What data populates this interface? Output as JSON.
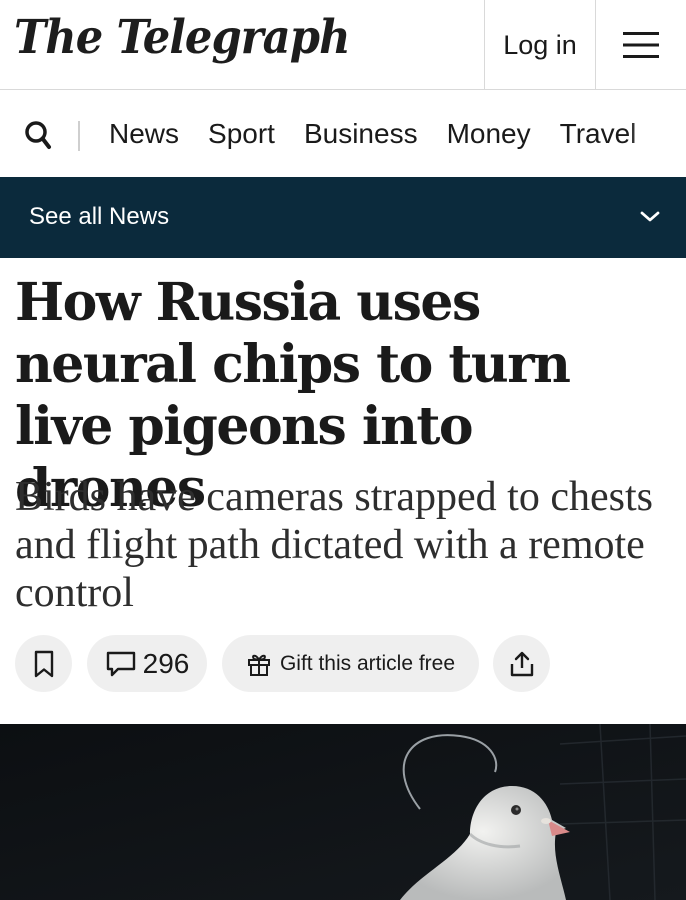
{
  "header": {
    "logo_text": "The Telegraph",
    "login_label": "Log in",
    "menu_icon": "hamburger-menu-icon"
  },
  "nav": {
    "search_icon": "search-icon",
    "items": [
      "News",
      "Sport",
      "Business",
      "Money",
      "Travel"
    ]
  },
  "section_bar": {
    "label": "See all News",
    "icon": "chevron-down-icon",
    "background": "#0b2a3c"
  },
  "article": {
    "headline": "How Russia uses neural chips to turn live pigeons into drones",
    "standfirst": "Birds have cameras strapped to chests and flight path dictated with a remote control"
  },
  "actions": {
    "bookmark_icon": "bookmark-icon",
    "comment_icon": "comment-icon",
    "comment_count": "296",
    "gift_icon": "gift-icon",
    "gift_label": "Gift this article free",
    "share_icon": "share-icon"
  },
  "colors": {
    "section_bar": "#0b2a3c",
    "pill_background": "#efefef"
  }
}
